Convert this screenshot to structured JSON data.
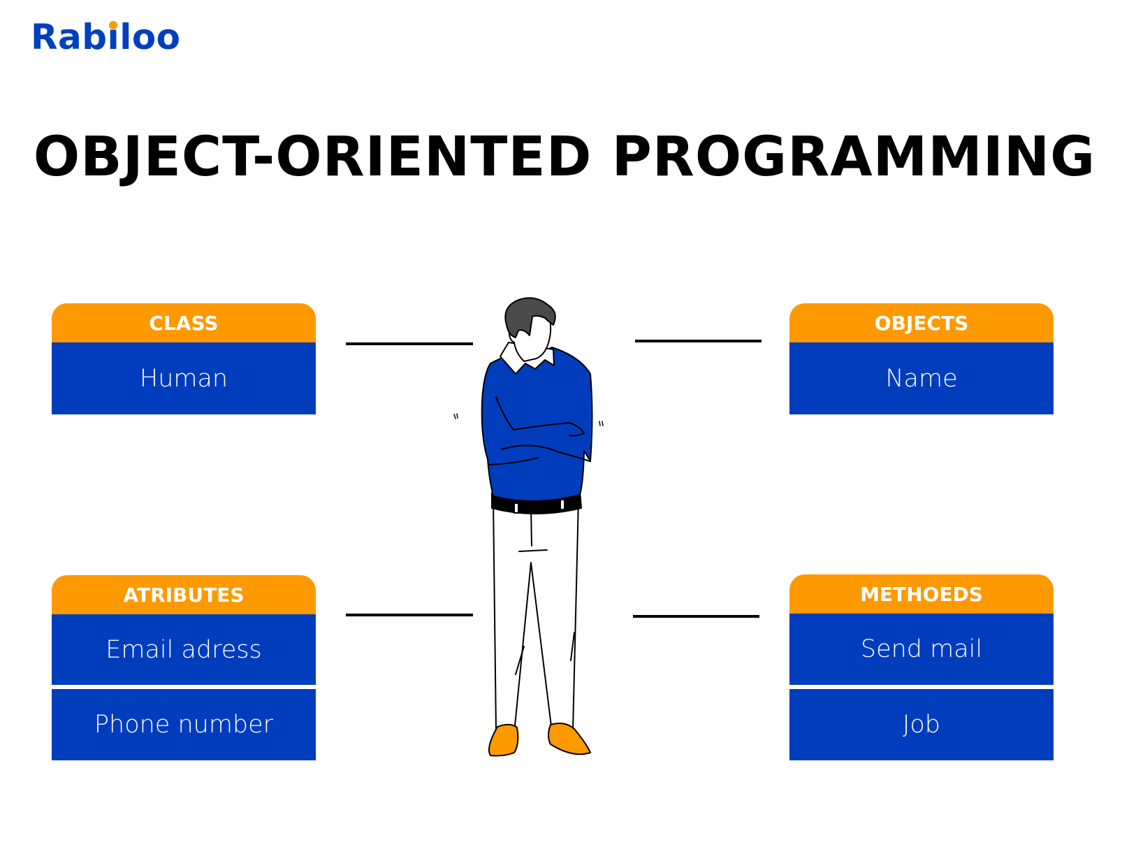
{
  "brand": {
    "logo_prefix": "Rab",
    "logo_i": "ı",
    "logo_suffix": "loo",
    "primary_color": "#0040BF",
    "accent_color": "#FF9900"
  },
  "title": "OBJECT-ORIENTED PROGRAMMING",
  "cards": {
    "class": {
      "header": "CLASS",
      "items": [
        "Human"
      ]
    },
    "objects": {
      "header": "OBJECTS",
      "items": [
        "Name"
      ]
    },
    "attributes": {
      "header": "ATRIBUTES",
      "items": [
        "Email adress",
        "Phone number"
      ]
    },
    "methods": {
      "header": "METHOEDS",
      "items": [
        "Send mail",
        "Job"
      ]
    }
  },
  "illustration": {
    "subject": "person-standing-arms-crossed",
    "sweater_color": "#003DBC",
    "shoes_color": "#FF9900",
    "hair_color": "#4A4A4A"
  }
}
